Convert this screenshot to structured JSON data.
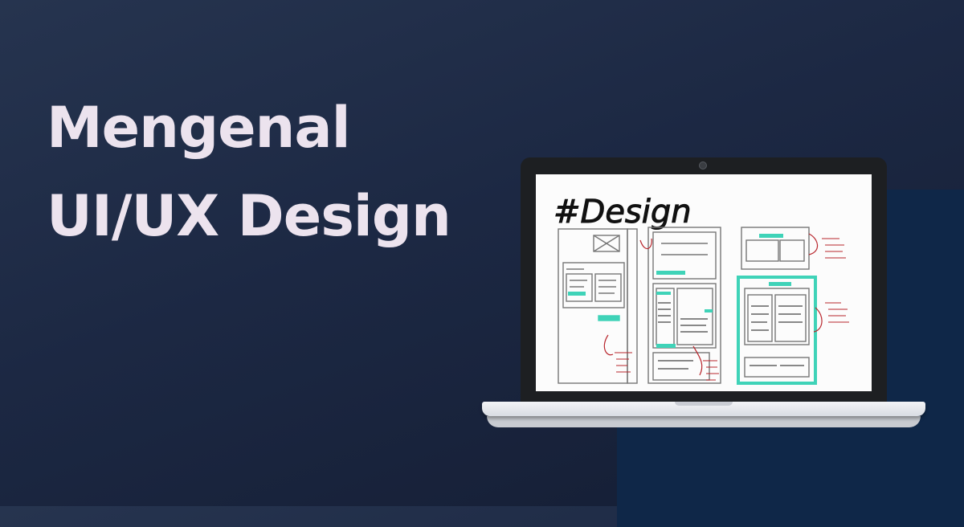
{
  "headline": {
    "line1": "Mengenal",
    "line2": "UI/UX Design"
  },
  "screen": {
    "sketch_title": "#Design"
  },
  "colors": {
    "background": "#1c2843",
    "headline": "#ece3ee",
    "accent_teal": "#3fd3b8",
    "annotation_red": "#b8262d"
  }
}
